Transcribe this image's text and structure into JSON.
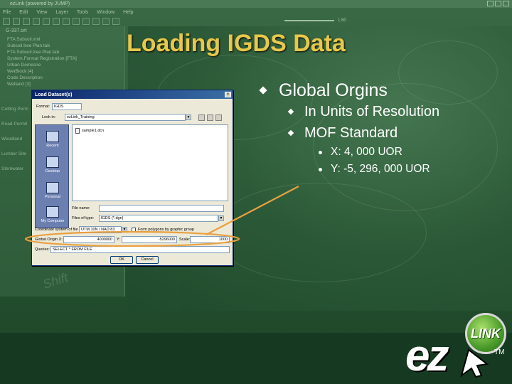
{
  "background_app": {
    "title": "ezLink (powered by JUMP)",
    "menu": [
      "File",
      "Edit",
      "View",
      "Layer",
      "Tools",
      "Window",
      "Help"
    ],
    "slider_label": "1:80",
    "panel_title": "G-337.ort",
    "tree": [
      "FTA Subsoil.xml",
      "Subsoil.tree Plan.tab",
      "FTA Subsoil.tree Plan.tab",
      "System.Format Registration [FTA]",
      "Urban Demesne",
      "WetBlock [4]",
      "Code Description",
      "Wetland [3]"
    ],
    "side_labels": [
      "Cutting Perm",
      "Road Permit",
      "Woodland",
      "Lumber Site",
      "Stemwater"
    ],
    "watermark": "Shift"
  },
  "slide": {
    "title": "Loading IGDS Data",
    "bullet_1": "Global Orgins",
    "sub_1": "In Units of Resolution",
    "sub_2": "MOF Standard",
    "point_1": "X: 4, 000 UOR",
    "point_2": "Y: -5, 296, 000 UOR"
  },
  "dialog": {
    "title": "Load Dataset(s)",
    "format_label": "Format:",
    "format_value": "IGDS",
    "lookin_label": "Look in:",
    "lookin_value": "ezLink_Training",
    "file": "sample1.dcn",
    "places": [
      "Recent",
      "Desktop",
      "Personal",
      "My Computer"
    ],
    "filename_label": "File name:",
    "filename_value": "",
    "filetype_label": "Files of type:",
    "filetype_value": "IGDS (*.dgn)",
    "coord_label": "Coordinate system of file",
    "coord_value": "UTM 10N / NAD 83",
    "polygon_label": "Form polygons by graphic group",
    "origin_label": "Global Origin X:",
    "origin_x": "4000000",
    "origin_y_label": "Y:",
    "origin_y": "-5296000",
    "scale_label": "Scale:",
    "scale_value": "1000",
    "query_label": "Queries:",
    "query_value": "SELECT * FROM FILE",
    "ok_label": "OK",
    "cancel_label": "Cancel"
  },
  "logo": {
    "brand": "ez",
    "badge": "LINK",
    "tm": "TM"
  },
  "colors": {
    "title": "#e8c84a",
    "annotation": "#e8a040",
    "background": "#1f4a2c"
  }
}
